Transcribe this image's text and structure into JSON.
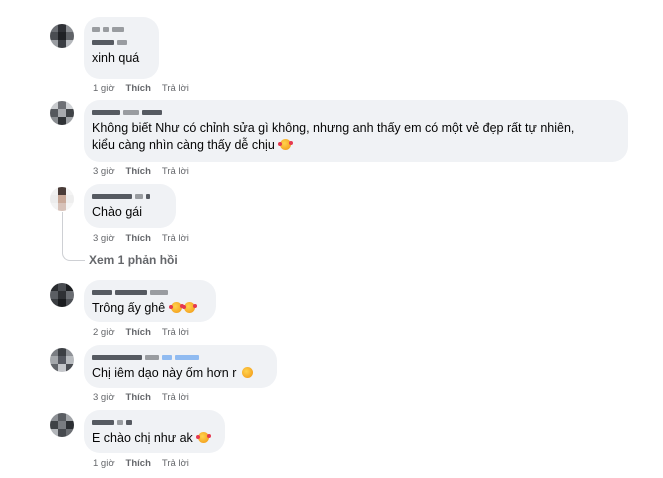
{
  "comments": [
    {
      "text": "xinh quá",
      "time": "1 giờ",
      "like": "Thích",
      "reply": "Trả lời",
      "emoji": ""
    },
    {
      "text1": "Không biết Như có chỉnh sửa gì không, nhưng anh thấy em có một vẻ đẹp rất tự nhiên,",
      "text2": "kiểu càng nhìn càng thấy dễ chịu",
      "time": "3 giờ",
      "like": "Thích",
      "reply": "Trả lời",
      "emoji": "smiling-face-with-hearts"
    },
    {
      "text": "Chào gái",
      "time": "3 giờ",
      "like": "Thích",
      "reply": "Trả lời",
      "emoji": ""
    },
    {
      "text": "Trông ấy ghê",
      "time": "2 giờ",
      "like": "Thích",
      "reply": "Trả lời",
      "emoji": "smiling-face-with-hearts x2"
    },
    {
      "text": "Chị iêm dạo này ốm hơn r",
      "time": "3 giờ",
      "like": "Thích",
      "reply": "Trả lời",
      "emoji": "grimacing-face"
    },
    {
      "text": "E chào chị như ak",
      "time": "1 giờ",
      "like": "Thích",
      "reply": "Trả lời",
      "emoji": "smiling-face-with-hearts"
    }
  ],
  "view_replies": "Xem 1 phản hồi"
}
